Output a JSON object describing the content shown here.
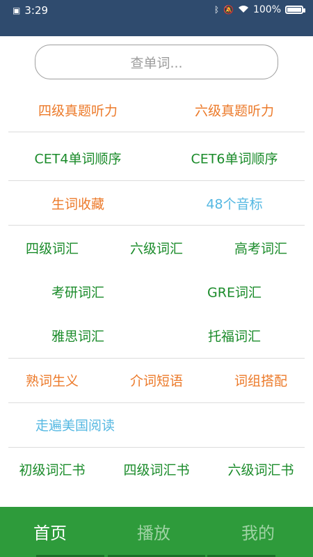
{
  "status": {
    "time": "3:29",
    "left_icon": "notification-icon",
    "battery_percent": "100%",
    "icons": [
      "bluetooth-icon",
      "mute-icon",
      "wifi-icon",
      "battery-icon"
    ]
  },
  "search": {
    "placeholder": "查单词..."
  },
  "rows": [
    {
      "items": [
        {
          "label": "四级真题听力",
          "color": "orange"
        },
        {
          "label": "六级真题听力",
          "color": "orange"
        }
      ]
    },
    {
      "items": [
        {
          "label": "CET4单词顺序",
          "color": "green"
        },
        {
          "label": "CET6单词顺序",
          "color": "green"
        }
      ]
    },
    {
      "items": [
        {
          "label": "生词收藏",
          "color": "orange"
        },
        {
          "label": "48个音标",
          "color": "blue"
        }
      ]
    },
    {
      "items": [
        {
          "label": "四级词汇",
          "color": "green"
        },
        {
          "label": "六级词汇",
          "color": "green"
        },
        {
          "label": "高考词汇",
          "color": "green"
        }
      ]
    },
    {
      "items": [
        {
          "label": "考研词汇",
          "color": "green"
        },
        {
          "label": "GRE词汇",
          "color": "green"
        }
      ]
    },
    {
      "items": [
        {
          "label": "雅思词汇",
          "color": "green"
        },
        {
          "label": "托福词汇",
          "color": "green"
        }
      ]
    },
    {
      "items": [
        {
          "label": "熟词生义",
          "color": "orange"
        },
        {
          "label": "介词短语",
          "color": "orange"
        },
        {
          "label": "词组搭配",
          "color": "orange"
        }
      ]
    },
    {
      "items": [
        {
          "label": "走遍美国阅读",
          "color": "blue"
        }
      ]
    },
    {
      "items": [
        {
          "label": "初级词汇书",
          "color": "green"
        },
        {
          "label": "四级词汇书",
          "color": "green"
        },
        {
          "label": "六级词汇书",
          "color": "green"
        }
      ]
    }
  ],
  "tabs": [
    {
      "label": "首页",
      "active": true
    },
    {
      "label": "播放",
      "active": false
    },
    {
      "label": "我的",
      "active": false
    }
  ],
  "colors": {
    "status_bar": "#2f4b6e",
    "tab_bar": "#2e9b3b",
    "orange": "#ec7a2a",
    "green": "#1a8b2a",
    "blue": "#55b8e2"
  }
}
